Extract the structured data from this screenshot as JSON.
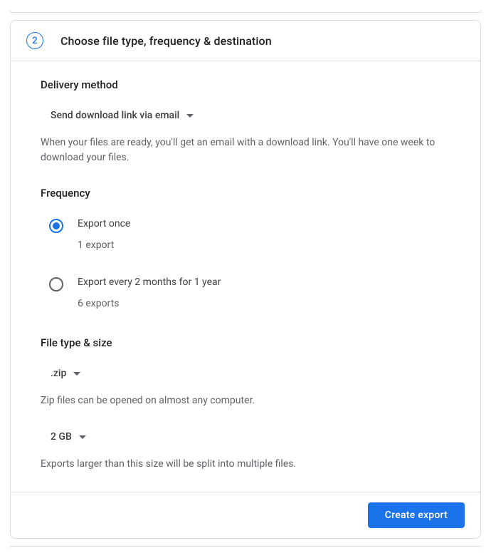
{
  "step": {
    "number": "2",
    "title": "Choose file type, frequency & destination"
  },
  "delivery": {
    "label": "Delivery method",
    "selected": "Send download link via email",
    "help": "When your files are ready, you'll get an email with a download link. You'll have one week to download your files."
  },
  "frequency": {
    "label": "Frequency",
    "options": [
      {
        "label": "Export once",
        "sub": "1 export",
        "selected": true
      },
      {
        "label": "Export every 2 months for 1 year",
        "sub": "6 exports",
        "selected": false
      }
    ]
  },
  "filetype": {
    "label": "File type & size",
    "type_selected": ".zip",
    "type_help": "Zip files can be opened on almost any computer.",
    "size_selected": "2 GB",
    "size_help": "Exports larger than this size will be split into multiple files."
  },
  "actions": {
    "create": "Create export"
  }
}
